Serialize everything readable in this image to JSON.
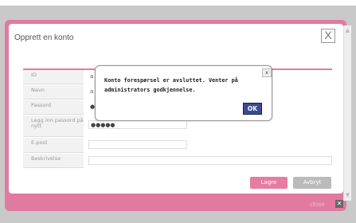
{
  "dialog": {
    "title": "Opprett en konto",
    "close_glyph": "X"
  },
  "form": {
    "fields": [
      {
        "label": "ID",
        "value": "a"
      },
      {
        "label": "Navn",
        "value": "a"
      },
      {
        "label": "Passord",
        "value": "●"
      },
      {
        "label": "Legg inn passord på nytt",
        "value": "●●●●●"
      },
      {
        "label": "E-post",
        "value": ""
      },
      {
        "label": "Beskrivelse",
        "value": ""
      }
    ],
    "save_label": "Lagre",
    "cancel_label": "Avbryt"
  },
  "footer": {
    "close_label": "close",
    "close_glyph": "✕"
  },
  "alert": {
    "message": "Konto forespørsel er avsluttet. Venter på administrators godkjennelse.",
    "close_glyph": "x",
    "ok_label": "OK"
  },
  "colors": {
    "accent": "#e07aa0",
    "ok_button": "#3a4a9a"
  },
  "icons": [
    "close-icon",
    "scroll-up-icon",
    "scroll-down-icon"
  ]
}
